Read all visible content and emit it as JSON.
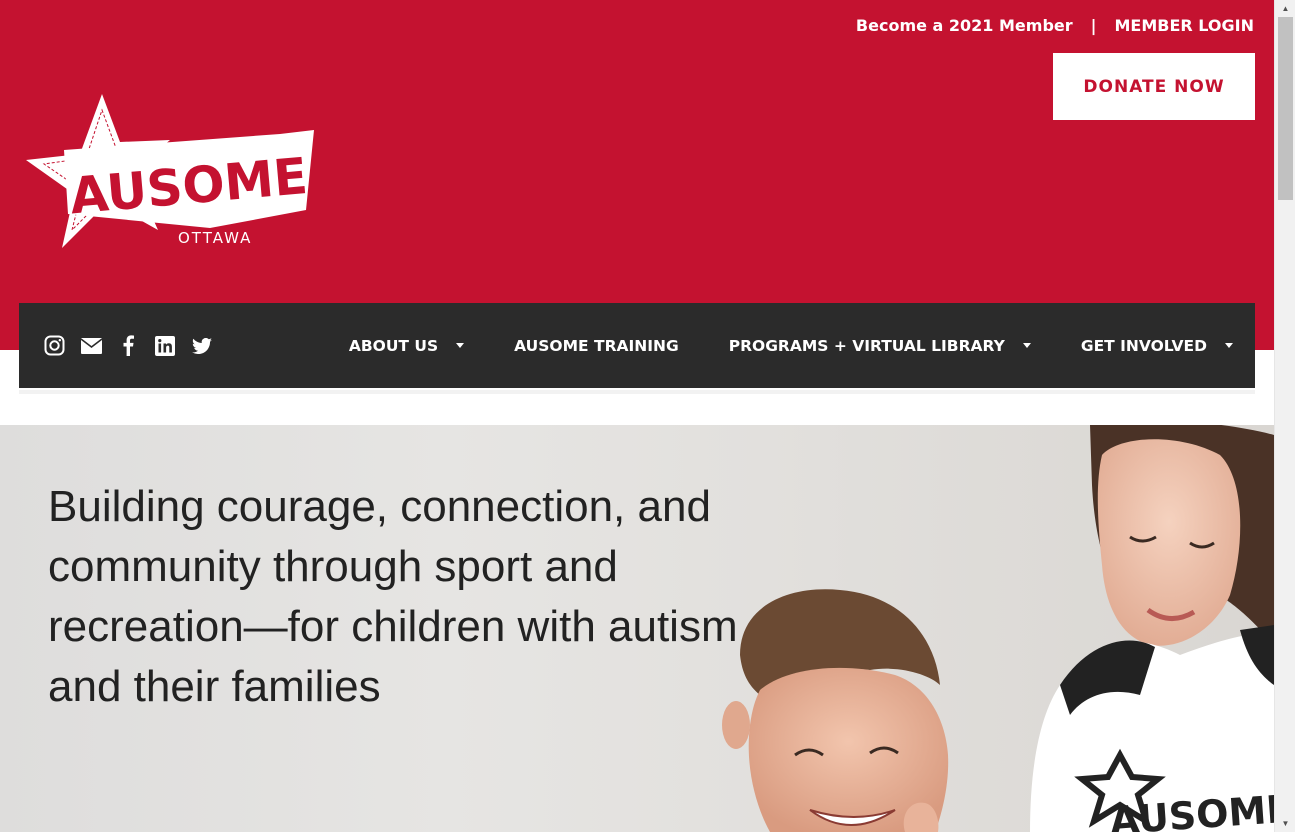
{
  "header": {
    "member_link": "Become a 2021 Member",
    "separator": "|",
    "login_link": "MEMBER LOGIN",
    "donate_label": "DONATE NOW",
    "logo": {
      "text": "AUSOME",
      "subtext": "OTTAWA",
      "icon": "star-logo-icon"
    }
  },
  "nav": {
    "social": [
      "instagram-icon",
      "email-icon",
      "facebook-icon",
      "linkedin-icon",
      "twitter-icon"
    ],
    "items": [
      {
        "label": "ABOUT US",
        "dropdown": true
      },
      {
        "label": "AUSOME TRAINING",
        "dropdown": false
      },
      {
        "label": "PROGRAMS + VIRTUAL LIBRARY",
        "dropdown": true
      },
      {
        "label": "GET INVOLVED",
        "dropdown": true
      }
    ]
  },
  "hero": {
    "heading": "Building courage, connection, and community through sport and recreation—for children with autism and their families",
    "shirt_text": "AUSOME"
  },
  "colors": {
    "brand_red": "#c41230",
    "nav_dark": "#2b2b2b",
    "white": "#ffffff"
  }
}
